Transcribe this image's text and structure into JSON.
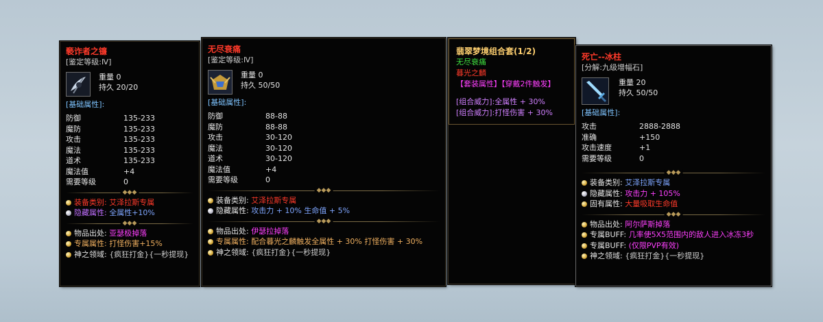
{
  "colors": {
    "red": "#ff3a2a",
    "set_title": "#ffd070",
    "green": "#40e040",
    "magenta": "#ff40ff",
    "blue": "#7fa6ff",
    "section": "#7fc4ff",
    "orange": "#f0b060",
    "purple": "#c070ff"
  },
  "item1": {
    "name": "褻诈者之镰",
    "grade": "[鉴定等级:Ⅳ]",
    "weight_label": "重量",
    "weight": "0",
    "durability_label": "持久",
    "durability": "20/20",
    "base_header": "[基础属性]:",
    "stats": [
      {
        "k": "防御",
        "v": "135-233"
      },
      {
        "k": "魔防",
        "v": "135-233"
      },
      {
        "k": "攻击",
        "v": "135-233"
      },
      {
        "k": "魔法",
        "v": "135-233"
      },
      {
        "k": "道术",
        "v": "135-233"
      },
      {
        "k": "魔法值",
        "v": "+4"
      },
      {
        "k": "需要等级",
        "v": "0"
      }
    ],
    "equip_type_label": "装备类别:",
    "equip_type": "艾泽拉斯专属",
    "hidden_label": "隐藏属性:",
    "hidden": "全属性+10%",
    "origin_label": "物品出处:",
    "origin": "亚瑟极掉落",
    "exclusive_label": "专属属性:",
    "exclusive": "打怪伤害+15%",
    "god_label": "神之领域:",
    "god": "{疯狂打金}{一秒提现}"
  },
  "item2": {
    "name": "无尽衰痛",
    "grade": "[鉴定等级:Ⅳ]",
    "weight_label": "重量",
    "weight": "0",
    "durability_label": "持久",
    "durability": "50/50",
    "base_header": "[基础属性]:",
    "stats": [
      {
        "k": "防御",
        "v": "88-88"
      },
      {
        "k": "魔防",
        "v": "88-88"
      },
      {
        "k": "攻击",
        "v": "30-120"
      },
      {
        "k": "魔法",
        "v": "30-120"
      },
      {
        "k": "道术",
        "v": "30-120"
      },
      {
        "k": "魔法值",
        "v": "+4"
      },
      {
        "k": "需要等级",
        "v": "0"
      }
    ],
    "equip_type_label": "装备类别:",
    "equip_type": "艾泽拉斯专属",
    "hidden_label": "隐藏属性:",
    "hidden": "攻击力 + 10% 生命值 + 5%",
    "origin_label": "物品出处:",
    "origin": "伊瑟拉掉落",
    "exclusive_label": "专属属性:",
    "exclusive": "配合暮光之麟触发全属性 + 30% 打怪伤害 + 30%",
    "god_label": "神之领域:",
    "god": "{疯狂打金}{一秒提现}"
  },
  "set": {
    "title": "翡翠梦境组合套(1/2)",
    "piece1": "无尽衰痛",
    "piece2": "暮光之麟",
    "set_attr": "【套装属性】【穿戴2件触发】",
    "bonus1": "[组合威力]:全属性 + 30%",
    "bonus2": "[组合威力]:打怪伤害 + 30%"
  },
  "item3": {
    "name": "死亡--冰柱",
    "decompose": "[分解:九级增幅石]",
    "weight_label": "重量",
    "weight": "20",
    "durability_label": "持久",
    "durability": "50/50",
    "base_header": "[基础属性]:",
    "stats": [
      {
        "k": "攻击",
        "v": "2888-2888"
      },
      {
        "k": "准确",
        "v": "+150"
      },
      {
        "k": "攻击速度",
        "v": "+1"
      },
      {
        "k": "需要等级",
        "v": "0"
      }
    ],
    "equip_type_label": "装备类别:",
    "equip_type": "艾泽拉斯专属",
    "hidden_label": "隐藏属性:",
    "hidden": "攻击力 + 105%",
    "inherent_label": "固有属性:",
    "inherent": "大量吸取生命值",
    "origin_label": "物品出处:",
    "origin": "阿尔萨斯掉落",
    "buff1_label": "专属BUFF:",
    "buff1": "几率使5X5范围内的敌人进入冰冻3秒",
    "buff2_label": "专属BUFF:",
    "buff2": "(仅限PVP有效)",
    "god_label": "神之领域:",
    "god": "{疯狂打金}{一秒提现}"
  }
}
